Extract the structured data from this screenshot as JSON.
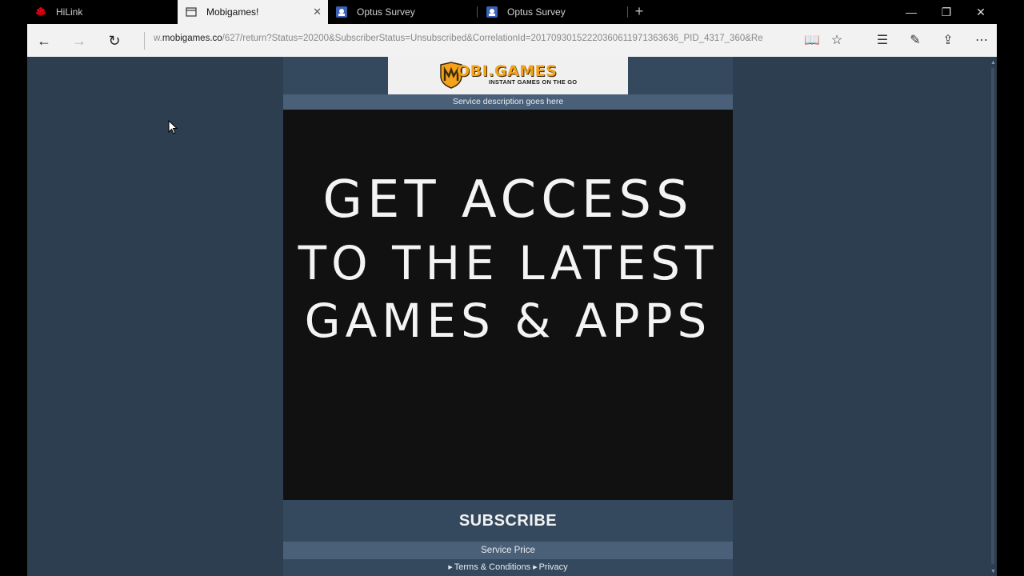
{
  "tabs": [
    {
      "title": "HiLink",
      "icon": "huawei-logo-icon"
    },
    {
      "title": "Mobigames!",
      "icon": "page-icon",
      "active": true
    },
    {
      "title": "Optus Survey",
      "icon": "survey-icon"
    },
    {
      "title": "Optus Survey",
      "icon": "survey-icon"
    }
  ],
  "address": {
    "prefix": "w.",
    "host": "mobigames.co",
    "path": "/627/return?Status=20200&SubscriberStatus=Unsubscribed&CorrelationId=20170930152220360611971363636_PID_4317_360&Re"
  },
  "logo": {
    "title": "OBI.GAMES",
    "tagline": "INSTANT GAMES ON THE GO",
    "brand_color": "#f3a21a"
  },
  "page": {
    "service_description": "Service description goes here",
    "hero": [
      "GET ACCESS",
      "TO THE LATEST",
      "GAMES & APPS"
    ],
    "subscribe_label": "SUBSCRIBE",
    "service_price": "Service Price",
    "links": [
      "Terms & Conditions",
      "Privacy"
    ]
  },
  "colors": {
    "page_bg": "#2d3e50",
    "panel_bg": "#34495e",
    "bar_bg": "#4a6078",
    "hero_bg": "#111112"
  }
}
